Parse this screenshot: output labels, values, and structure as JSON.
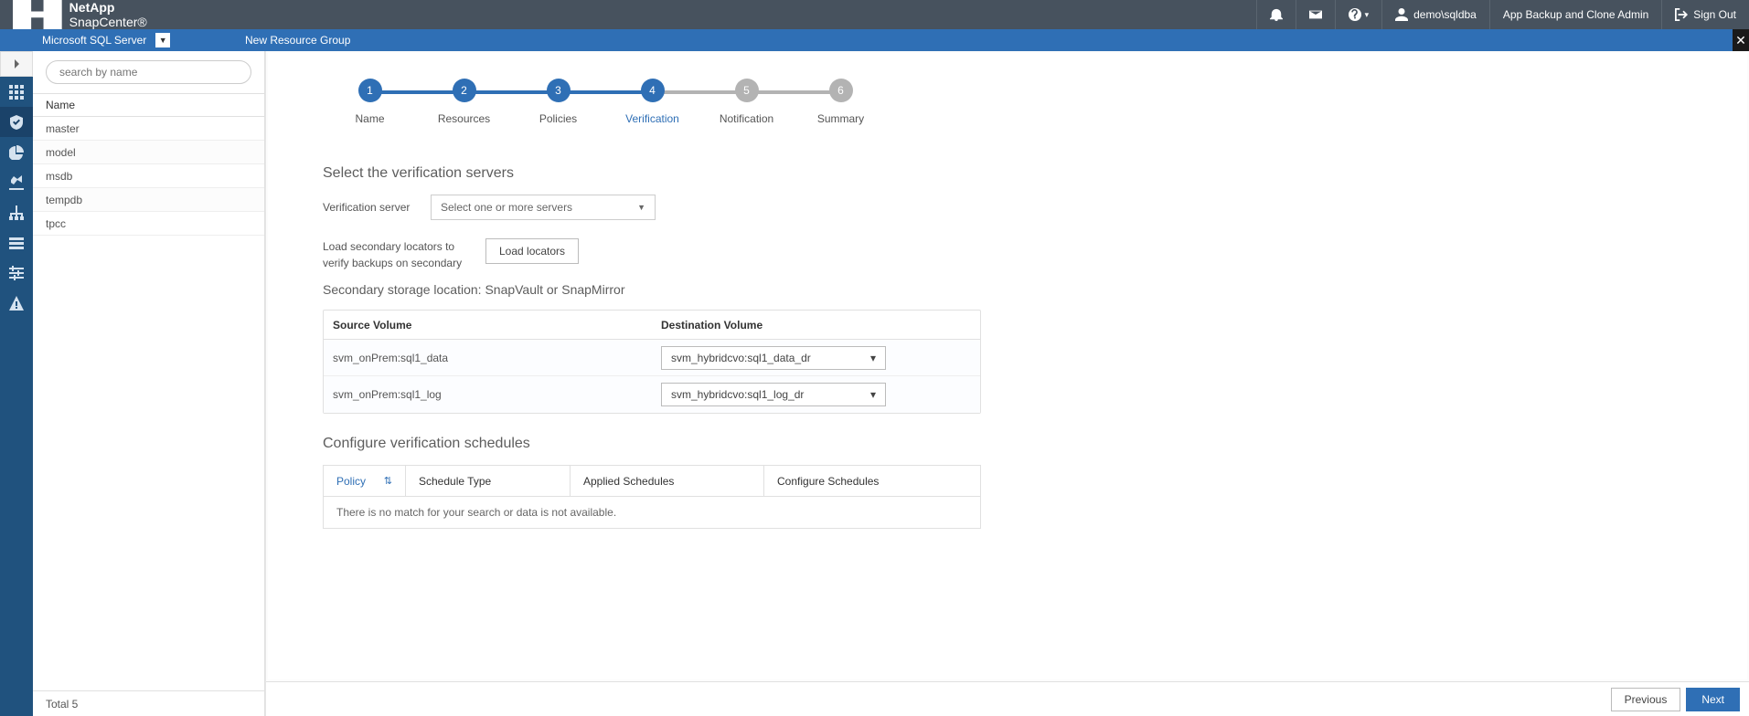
{
  "brand": {
    "company": "NetApp",
    "product": "SnapCenter®"
  },
  "topbar": {
    "user": "demo\\sqldba",
    "role": "App Backup and Clone Admin",
    "signout": "Sign Out"
  },
  "subbar": {
    "db_type": "Microsoft SQL Server",
    "title": "New Resource Group"
  },
  "sidebar": {
    "search_placeholder": "search by name",
    "header": "Name",
    "rows": [
      "master",
      "model",
      "msdb",
      "tempdb",
      "tpcc"
    ],
    "footer": "Total 5"
  },
  "stepper": [
    {
      "num": "1",
      "label": "Name",
      "state": "done"
    },
    {
      "num": "2",
      "label": "Resources",
      "state": "done"
    },
    {
      "num": "3",
      "label": "Policies",
      "state": "done"
    },
    {
      "num": "4",
      "label": "Verification",
      "state": "current"
    },
    {
      "num": "5",
      "label": "Notification",
      "state": "pending"
    },
    {
      "num": "6",
      "label": "Summary",
      "state": "pending"
    }
  ],
  "section1": {
    "title": "Select the verification servers",
    "label": "Verification server",
    "placeholder": "Select one or more servers"
  },
  "section2": {
    "label": "Load secondary locators to verify backups on secondary",
    "button": "Load locators"
  },
  "section3": {
    "title": "Secondary storage location: SnapVault or SnapMirror",
    "col1": "Source Volume",
    "col2": "Destination Volume",
    "rows": [
      {
        "source": "svm_onPrem:sql1_data",
        "dest": "svm_hybridcvo:sql1_data_dr"
      },
      {
        "source": "svm_onPrem:sql1_log",
        "dest": "svm_hybridcvo:sql1_log_dr"
      }
    ]
  },
  "section4": {
    "title": "Configure verification schedules",
    "cols": [
      "Policy",
      "Schedule Type",
      "Applied Schedules",
      "Configure Schedules"
    ],
    "empty": "There is no match for your search or data is not available."
  },
  "footer": {
    "prev": "Previous",
    "next": "Next"
  }
}
